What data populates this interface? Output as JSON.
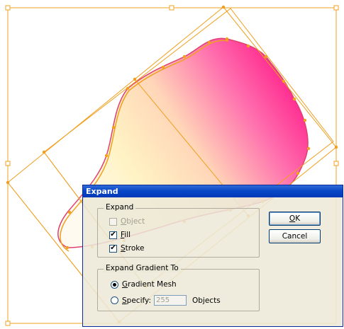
{
  "dialog": {
    "title": "Expand",
    "expand_group": {
      "title": "Expand",
      "object": {
        "label_first": "O",
        "label_rest": "bject",
        "checked": false,
        "disabled": true
      },
      "fill": {
        "label_first": "F",
        "label_rest": "ill",
        "checked": true
      },
      "stroke": {
        "label_first": "S",
        "label_rest": "troke",
        "checked": true
      }
    },
    "gradient_group": {
      "title": "Expand Gradient To",
      "gradient_mesh": {
        "label_first": "G",
        "label_rest": "radient Mesh",
        "selected": true
      },
      "specify": {
        "label_first": "S",
        "label_rest": "pecify:",
        "selected": false,
        "value": "255",
        "suffix": "Objects"
      }
    },
    "buttons": {
      "ok": {
        "label_first": "O",
        "label_rest": "K"
      },
      "cancel": {
        "label": "Cancel"
      }
    }
  },
  "colors": {
    "selection": "#f0a020",
    "titlebar": "#0a47c6",
    "shape_gradient_start": "#fff6c8",
    "shape_gradient_end": "#ff1e8c"
  }
}
